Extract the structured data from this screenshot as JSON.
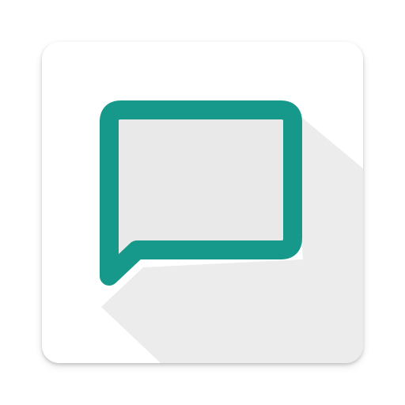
{
  "app_icon": {
    "icon_name": "chat-bubble-icon",
    "colors": {
      "tile_background": "#ffffff",
      "long_shadow": "#ececec",
      "bubble_fill": "#e9e9e9",
      "bubble_outline": "#16998a"
    }
  }
}
